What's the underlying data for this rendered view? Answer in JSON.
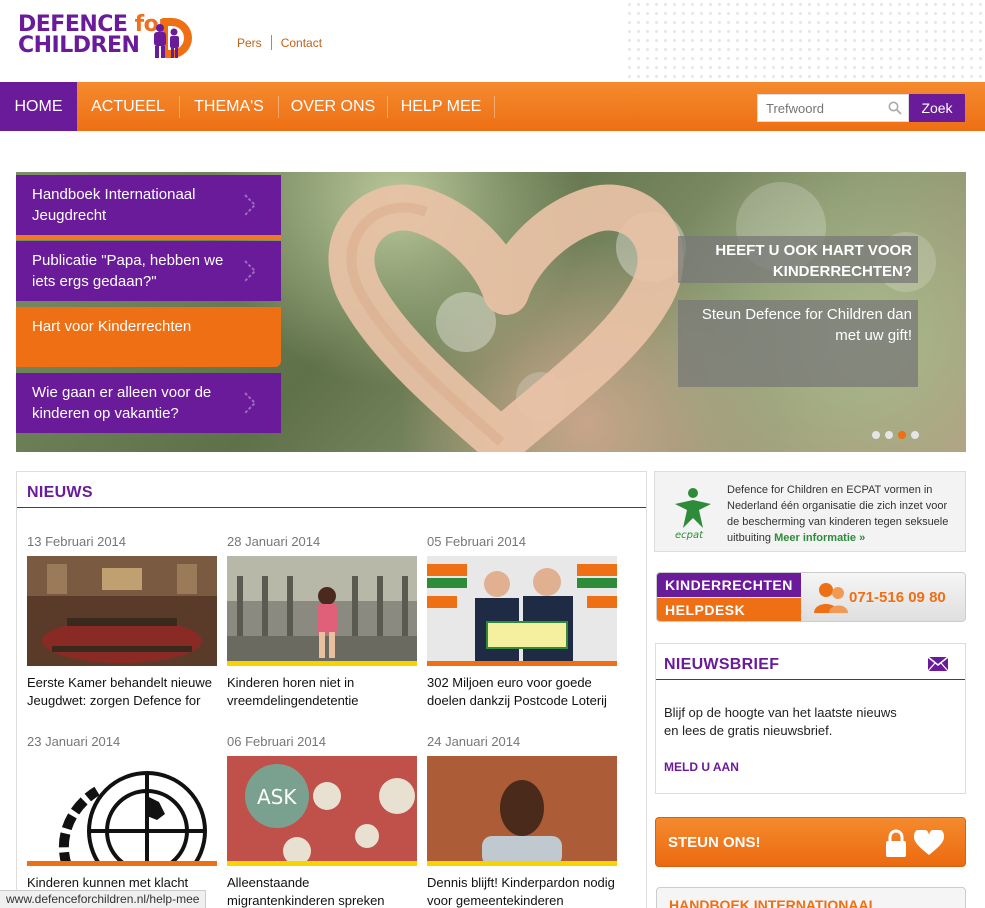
{
  "brand": {
    "line1": "DEFENCE ",
    "line1_accent": "for",
    "line2": "CHILDREN",
    "purple": "#6a1b9a",
    "orange": "#ee6f14"
  },
  "toplinks": [
    "Pers",
    "Contact"
  ],
  "nav": {
    "items": [
      "HOME",
      "ACTUEEL",
      "THEMA'S",
      "OVER ONS",
      "HELP MEE"
    ],
    "active": "HOME"
  },
  "search": {
    "placeholder": "Trefwoord",
    "button": "Zoek"
  },
  "hero": {
    "side_items": [
      "Handboek Internationaal Jeugdrecht",
      "Publicatie \"Papa, hebben we iets ergs gedaan?\"",
      "Hart voor Kinderrechten",
      "Wie gaan er alleen voor de kinderen op vakantie?"
    ],
    "active_side_item": 2,
    "caption_title": "HEEFT U OOK HART VOOR KINDERRECHTEN?",
    "caption_sub": "Steun Defence for Children dan met uw gift!",
    "slide_count": 4,
    "active_slide": 2
  },
  "news": {
    "title": "NIEUWS",
    "items": [
      {
        "date": "13 Februari 2014",
        "text": "Eerste Kamer behandelt nieuwe Jeugdwet: zorgen Defence for"
      },
      {
        "date": "28 Januari 2014",
        "text": "Kinderen horen niet in vreemdelingendetentie"
      },
      {
        "date": "05 Februari 2014",
        "text": "302 Miljoen euro voor goede doelen dankzij Postcode Loterij"
      },
      {
        "date": "23 Januari 2014",
        "text": "Kinderen kunnen met klacht"
      },
      {
        "date": "06 Februari 2014",
        "text": "Alleenstaande migrantenkinderen spreken"
      },
      {
        "date": "24 Januari 2014",
        "text": "Dennis blijft! Kinderpardon nodig voor gemeentekinderen"
      }
    ]
  },
  "ecpat": {
    "text": "Defence for Children en ECPAT vormen in Nederland één organisatie die zich inzet voor de bescherming van kinderen tegen seksuele uitbuiting",
    "more": "Meer informatie »",
    "logo_label": "ecpat"
  },
  "helpdesk": {
    "line1": "KINDERRECHTEN",
    "line2": "HELPDESK",
    "phone": "071-516 09 80"
  },
  "newsletter": {
    "title": "NIEUWSBRIEF",
    "text1": "Blijf op de hoogte van het laatste nieuws",
    "text2": "en lees de gratis nieuwsbrief.",
    "link": "MELD U AAN"
  },
  "steun": {
    "label": "STEUN ONS!"
  },
  "handboek": {
    "label": "HANDBOEK INTERNATIONAAL"
  },
  "status_url": "www.defenceforchildren.nl/help-mee"
}
